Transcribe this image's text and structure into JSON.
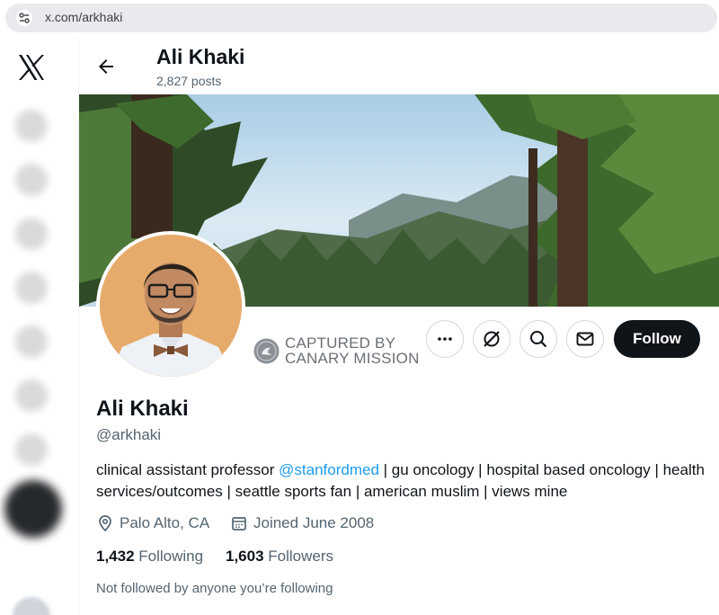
{
  "browser": {
    "url": "x.com/arkhaki"
  },
  "header": {
    "name": "Ali Khaki",
    "posts": "2,827 posts"
  },
  "watermark": {
    "line1": "CAPTURED BY",
    "line2": "CANARY MISSION"
  },
  "actions": {
    "follow_label": "Follow"
  },
  "profile": {
    "name": "Ali Khaki",
    "handle": "@arkhaki",
    "bio_prefix": "clinical assistant professor ",
    "bio_mention": "@stanfordmed",
    "bio_rest": " | gu oncology | hospital based oncology | health services/outcomes | seattle sports fan | american muslim | views mine",
    "location": "Palo Alto, CA",
    "joined": "Joined June 2008",
    "following_count": "1,432",
    "following_label": "Following",
    "followers_count": "1,603",
    "followers_label": "Followers",
    "not_followed": "Not followed by anyone you’re following"
  },
  "colors": {
    "accent": "#1d9bf0",
    "text": "#0f1419",
    "muted": "#536471",
    "button_dark": "#0f1419"
  },
  "icons": [
    "site-settings-icon",
    "x-logo-icon",
    "back-arrow-icon",
    "more-icon",
    "grok-icon",
    "search-icon",
    "message-icon",
    "location-icon",
    "calendar-icon"
  ]
}
